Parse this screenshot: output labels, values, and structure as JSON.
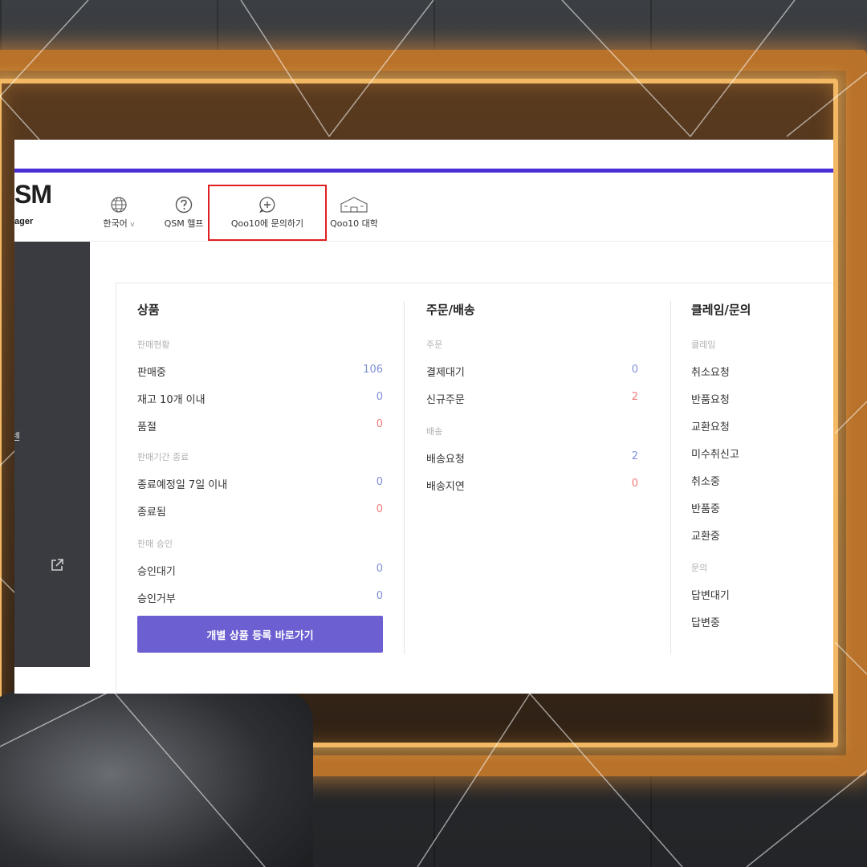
{
  "logo": {
    "main": "SM",
    "sub": "ager"
  },
  "nav": {
    "items": [
      {
        "label": "한국어",
        "icon": "globe-icon",
        "suffix": "v"
      },
      {
        "label": "QSM 헬프",
        "icon": "help-circle-icon"
      },
      {
        "label": "Qoo10에 문의하기",
        "icon": "chat-plus-icon",
        "highlighted": true
      },
      {
        "label": "Qoo10 대학",
        "icon": "school-building-icon"
      }
    ]
  },
  "sidebar": {
    "partial_text": "넨",
    "external_icon": "external-link-icon"
  },
  "products": {
    "title": "상품",
    "sales_status": {
      "title": "판매현황",
      "rows": [
        {
          "label": "판매중",
          "value": "106"
        },
        {
          "label": "재고 10개 이내",
          "value": "0"
        },
        {
          "label": "품절",
          "value": "0"
        }
      ]
    },
    "sales_period_end": {
      "title": "판매기간 종료",
      "rows": [
        {
          "label": "종료예정일 7일 이내",
          "value": "0"
        },
        {
          "label": "종료됨",
          "value": "0"
        }
      ]
    },
    "sales_approval": {
      "title": "판매 승인",
      "rows": [
        {
          "label": "승인대기",
          "value": "0"
        },
        {
          "label": "승인거부",
          "value": "0"
        }
      ]
    },
    "register_button": "개별 상품 등록 바로가기"
  },
  "orders": {
    "title": "주문/배송",
    "order": {
      "title": "주문",
      "rows": [
        {
          "label": "결제대기",
          "value": "0"
        },
        {
          "label": "신규주문",
          "value": "2"
        }
      ]
    },
    "shipping": {
      "title": "배송",
      "rows": [
        {
          "label": "배송요청",
          "value": "2"
        },
        {
          "label": "배송지연",
          "value": "0"
        }
      ]
    }
  },
  "claims": {
    "title": "클레임/문의",
    "claim": {
      "title": "클레임",
      "rows": [
        "취소요청",
        "반품요청",
        "교환요청",
        "미수취신고",
        "취소중",
        "반품중",
        "교환중"
      ]
    },
    "inquiry": {
      "title": "문의",
      "rows": [
        "답변대기",
        "답변중"
      ]
    }
  },
  "colors": {
    "accent_bar": "#4a2fd4",
    "button": "#6b5fd1",
    "value_blue": "#7e8fd8",
    "value_red": "#ef7b7b",
    "highlight_box": "#e02020",
    "sidebar": "#3a3b40"
  }
}
